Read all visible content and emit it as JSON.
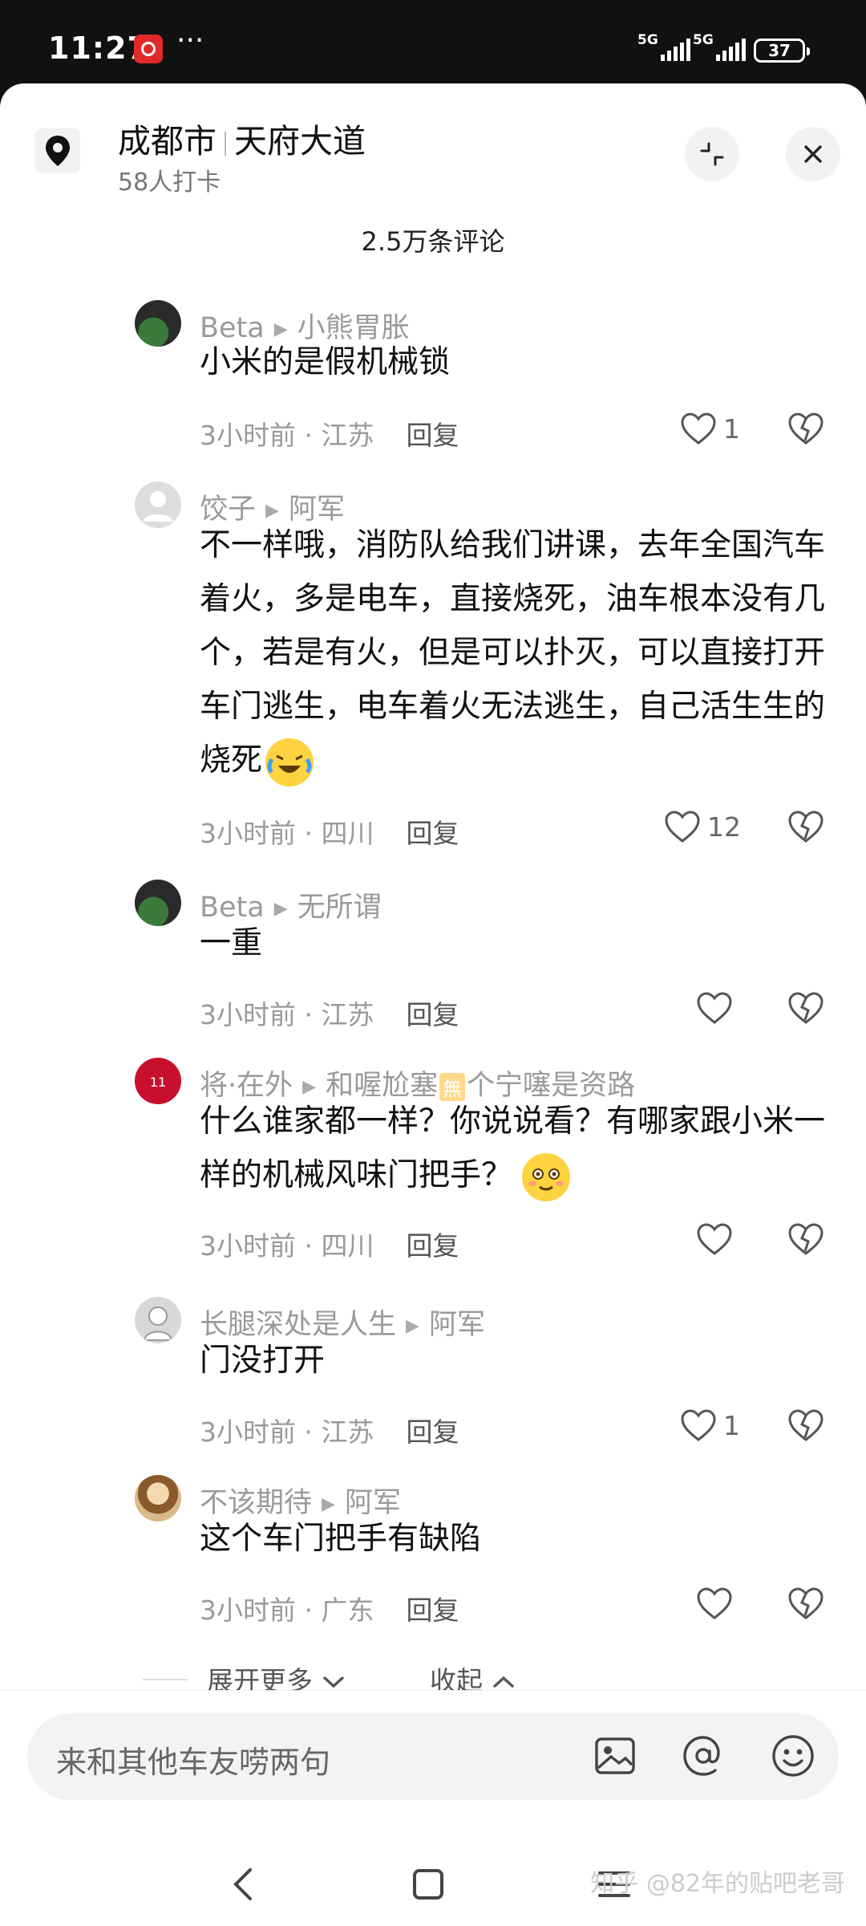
{
  "status": {
    "time": "11:27",
    "net1": "5G",
    "net2": "5G",
    "battery": "37"
  },
  "header": {
    "city": "成都市",
    "road": "天府大道",
    "checkins": "58人打卡"
  },
  "comment_count": "2.5万条评论",
  "comments": [
    {
      "user": "Beta",
      "reply_to": "小熊胃胀",
      "text": "小米的是假机械锁",
      "time": "3小时前",
      "region": "江苏",
      "reply_label": "回复",
      "likes": "1"
    },
    {
      "user": "饺子",
      "reply_to": "阿军",
      "text": "不一样哦，消防队给我们讲课，去年全国汽车着火，多是电车，直接烧死，油车根本没有几个，若是有火，但是可以扑灭，可以直接打开车门逃生，电车着火无法逃生，自己活生生的烧死",
      "time": "3小时前",
      "region": "四川",
      "reply_label": "回复",
      "likes": "12"
    },
    {
      "user": "Beta",
      "reply_to": "无所谓",
      "text": "一重",
      "time": "3小时前",
      "region": "江苏",
      "reply_label": "回复",
      "likes": ""
    },
    {
      "user": "将·在外",
      "reply_to": "和喔尬塞",
      "reply_to_suffix": "个宁噻是资路",
      "badge": "無",
      "text": "什么谁家都一样？你说说看？有哪家跟小米一样的机械风味门把手？",
      "time": "3小时前",
      "region": "四川",
      "reply_label": "回复",
      "likes": ""
    },
    {
      "user": "长腿深处是人生",
      "reply_to": "阿军",
      "text": "门没打开",
      "time": "3小时前",
      "region": "江苏",
      "reply_label": "回复",
      "likes": "1"
    },
    {
      "user": "不该期待",
      "reply_to": "阿军",
      "text": "这个车门把手有缺陷",
      "time": "3小时前",
      "region": "广东",
      "reply_label": "回复",
      "likes": ""
    }
  ],
  "footer": {
    "expand_more": "展开更多",
    "collapse": "收起"
  },
  "input": {
    "placeholder": "来和其他车友唠两句"
  },
  "watermark": "知乎 @82年的贴吧老哥"
}
